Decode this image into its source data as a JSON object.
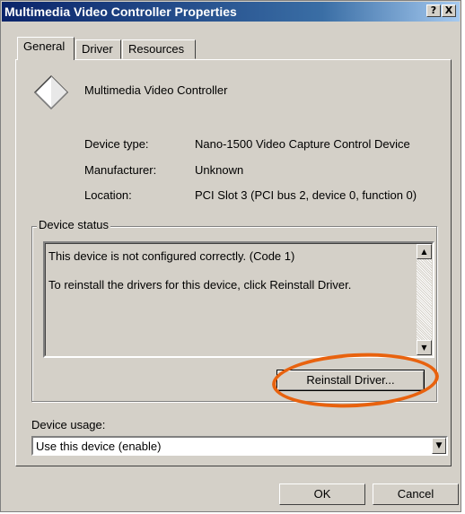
{
  "window": {
    "title": "Multimedia Video Controller Properties",
    "help_button": "?",
    "close_button": "X"
  },
  "tabs": [
    {
      "label": "General",
      "active": true
    },
    {
      "label": "Driver",
      "active": false
    },
    {
      "label": "Resources",
      "active": false
    }
  ],
  "device": {
    "name": "Multimedia Video Controller",
    "icon": "device-diamond-icon"
  },
  "properties": {
    "device_type_label": "Device type:",
    "device_type_value": "Nano-1500 Video Capture Control Device",
    "manufacturer_label": "Manufacturer:",
    "manufacturer_value": "Unknown",
    "location_label": "Location:",
    "location_value": "PCI Slot 3 (PCI bus 2, device 0, function 0)"
  },
  "device_status": {
    "legend": "Device status",
    "line1": "This device is not configured correctly. (Code 1)",
    "line2": "To reinstall the drivers for this device, click Reinstall Driver.",
    "reinstall_button": "Reinstall Driver..."
  },
  "device_usage": {
    "label": "Device usage:",
    "selected": "Use this device (enable)"
  },
  "footer": {
    "ok": "OK",
    "cancel": "Cancel"
  },
  "colors": {
    "title_bar": "#0a246a",
    "face": "#d4d0c8",
    "highlight_ellipse": "#e8620e"
  }
}
